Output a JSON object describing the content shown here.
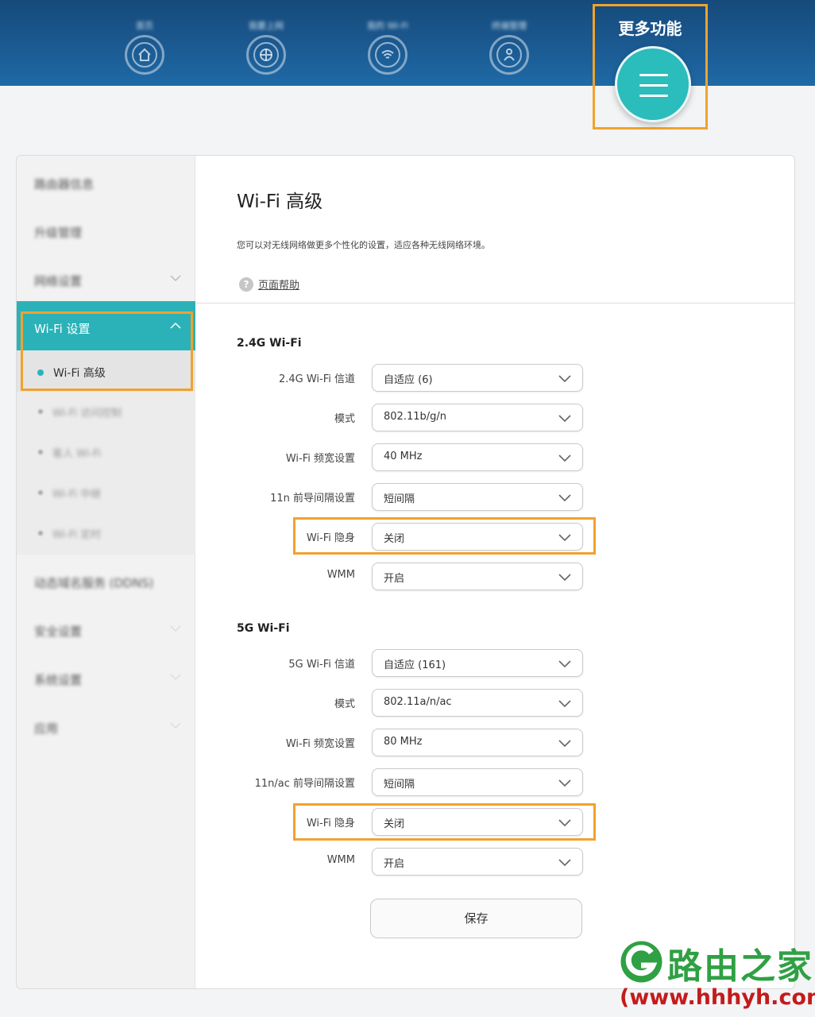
{
  "topnav": {
    "items": [
      {
        "label": "首页",
        "icon": "home-icon"
      },
      {
        "label": "我要上网",
        "icon": "globe-icon"
      },
      {
        "label": "我的 Wi-Fi",
        "icon": "wifi-icon"
      },
      {
        "label": "终端管理",
        "icon": "devices-icon"
      }
    ],
    "more_label": "更多功能",
    "more_icon": "menu-icon"
  },
  "sidebar": {
    "items": [
      {
        "label": "路由器信息"
      },
      {
        "label": "升级管理"
      },
      {
        "label": "网络设置"
      }
    ],
    "wifi_settings_label": "Wi-Fi 设置",
    "wifi_advanced_label": "Wi-Fi 高级",
    "wifi_sub_items": [
      {
        "label": "Wi-Fi 访问控制"
      },
      {
        "label": "客人 Wi-Fi"
      },
      {
        "label": "Wi-Fi 中继"
      },
      {
        "label": "Wi-Fi 定时"
      }
    ],
    "lower_items": [
      {
        "label": "动态域名服务 (DDNS)"
      },
      {
        "label": "安全设置"
      },
      {
        "label": "系统设置"
      },
      {
        "label": "应用"
      }
    ]
  },
  "content": {
    "title": "Wi-Fi 高级",
    "description": "您可以对无线网络做更多个性化的设置，适应各种无线网络环境。",
    "help_label": "页面帮助",
    "section_24g": {
      "title": "2.4G Wi-Fi",
      "rows": [
        {
          "label": "2.4G Wi-Fi 信道",
          "value": "自适应 (6)"
        },
        {
          "label": "模式",
          "value": "802.11b/g/n"
        },
        {
          "label": "Wi-Fi 频宽设置",
          "value": "40 MHz"
        },
        {
          "label": "11n 前导间隔设置",
          "value": "短间隔"
        },
        {
          "label": "Wi-Fi 隐身",
          "value": "关闭"
        },
        {
          "label": "WMM",
          "value": "开启"
        }
      ]
    },
    "section_5g": {
      "title": "5G Wi-Fi",
      "rows": [
        {
          "label": "5G Wi-Fi 信道",
          "value": "自适应 (161)"
        },
        {
          "label": "模式",
          "value": "802.11a/n/ac"
        },
        {
          "label": "Wi-Fi 频宽设置",
          "value": "80 MHz"
        },
        {
          "label": "11n/ac 前导间隔设置",
          "value": "短间隔"
        },
        {
          "label": "Wi-Fi 隐身",
          "value": "关闭"
        },
        {
          "label": "WMM",
          "value": "开启"
        }
      ]
    },
    "save_label": "保存"
  },
  "watermark": {
    "name": "路由之家",
    "url": "(www.hhhyh.com)"
  },
  "colors": {
    "accent": "#2bb2b8",
    "highlight": "#f0a22e",
    "topbar": "#1b5a92",
    "watermark_green": "#2fa043",
    "watermark_red": "#c41b1b"
  }
}
